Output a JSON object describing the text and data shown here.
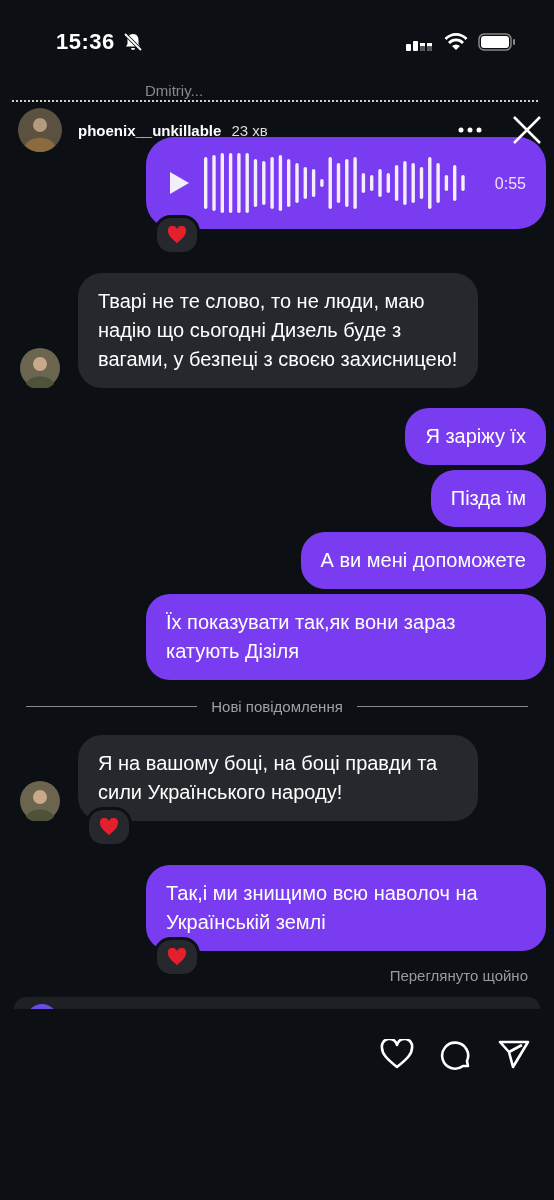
{
  "status_bar": {
    "time": "15:36",
    "silent": true
  },
  "behind_header": {
    "name": "Dmitriy..."
  },
  "story": {
    "username": "phoenix__unkillable",
    "time": "23 хв"
  },
  "messages": [
    {
      "kind": "voice",
      "duration": "0:55",
      "reacted": true
    },
    {
      "kind": "incoming",
      "text": "Тварі не те слово, то не люди, маю надію що сьогодні Дизель буде з вагами, у безпеці з своєю захисницею!",
      "avatar": true,
      "reacted": false
    },
    {
      "kind": "outgoing",
      "text": "Я заріжу їх",
      "reacted": false
    },
    {
      "kind": "outgoing",
      "text": "Пізда їм",
      "reacted": false
    },
    {
      "kind": "outgoing",
      "text": "А ви мені допоможете",
      "reacted": false
    },
    {
      "kind": "outgoing",
      "text": "Їх показувати так,як вони зараз катують Дізіля",
      "reacted": false
    },
    {
      "kind": "divider",
      "text": "Нові повідомлення"
    },
    {
      "kind": "incoming",
      "text": "Я на вашому боці, на боці правди та сили Українського народу!",
      "avatar": true,
      "reacted": true
    },
    {
      "kind": "outgoing",
      "text": "Так,і ми знищимо всю наволоч на Українській землі",
      "reacted": true
    }
  ],
  "seen": "Переглянуто щойно"
}
